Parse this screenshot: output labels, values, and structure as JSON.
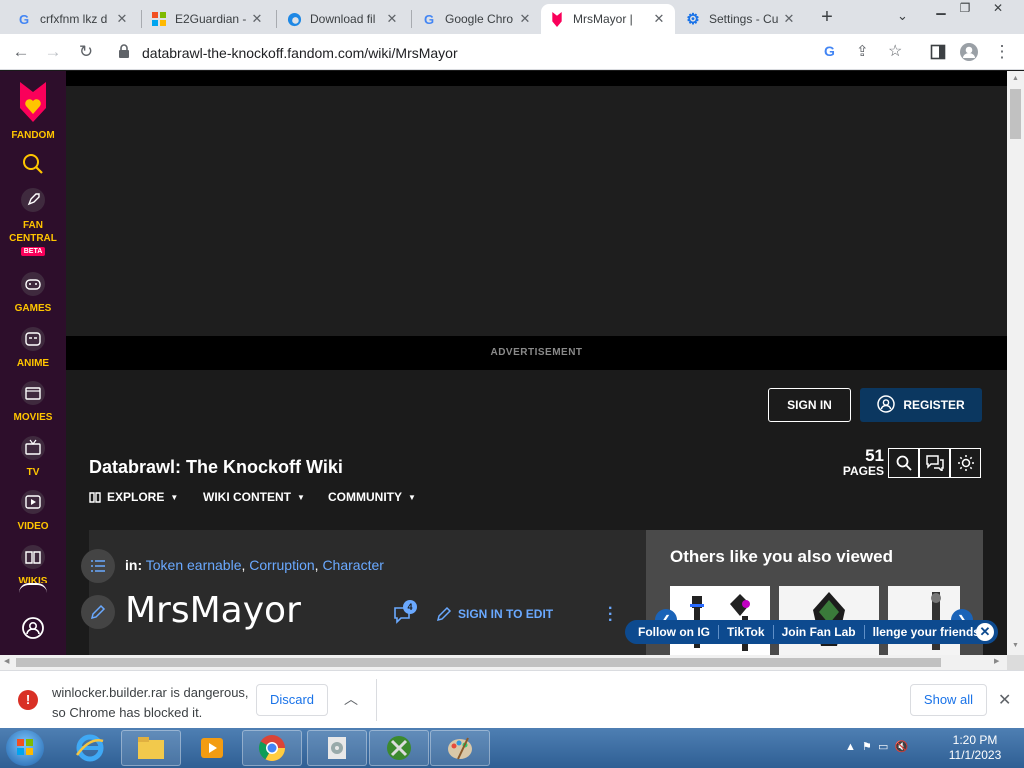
{
  "browser": {
    "tabs": [
      {
        "title": "crfxfnm lkz d",
        "icon": "google-icon"
      },
      {
        "title": "E2Guardian -",
        "icon": "windows-icon"
      },
      {
        "title": "Download fil",
        "icon": "edge-icon"
      },
      {
        "title": "Google Chro",
        "icon": "google-icon"
      },
      {
        "title": "MrsMayor | ",
        "icon": "fandom-icon",
        "active": true
      },
      {
        "title": "Settings - Cu",
        "icon": "gear-icon"
      }
    ],
    "url": "databrawl-the-knockoff.fandom.com/wiki/MrsMayor"
  },
  "rail": {
    "brand": "FANDOM",
    "items": [
      {
        "label": "FAN",
        "label2": "CENTRAL",
        "badge": "BETA"
      },
      {
        "label": "GAMES"
      },
      {
        "label": "ANIME"
      },
      {
        "label": "MOVIES"
      },
      {
        "label": "TV"
      },
      {
        "label": "VIDEO"
      },
      {
        "label": "WIKIS"
      }
    ]
  },
  "page": {
    "ad_label": "ADVERTISEMENT",
    "sign_in": "SIGN IN",
    "register": "REGISTER",
    "wiki_title": "Databrawl: The Knockoff Wiki",
    "pages_count": "51",
    "pages_label": "PAGES",
    "nav": [
      {
        "label": "EXPLORE"
      },
      {
        "label": "WIKI CONTENT"
      },
      {
        "label": "COMMUNITY"
      }
    ],
    "categories_prefix": "in:",
    "categories": [
      "Token earnable",
      "Corruption",
      "Character"
    ],
    "article_title": "MrsMayor",
    "talk_count": "4",
    "sign_in_to_edit": "SIGN IN TO EDIT",
    "others_title": "Others like you also viewed",
    "social": [
      "Follow on IG",
      "TikTok",
      "Join Fan Lab",
      "llenge your friends!"
    ]
  },
  "download": {
    "message_line1": "winlocker.builder.rar is dangerous,",
    "message_line2": "so Chrome has blocked it.",
    "discard": "Discard",
    "show_all": "Show all"
  },
  "taskbar": {
    "time": "1:20 PM",
    "date": "11/1/2023"
  },
  "colors": {
    "fandom_accent": "#fa005a",
    "rail_label": "#ffc500",
    "link": "#6aa9ff",
    "register_bg": "#0b3760"
  }
}
